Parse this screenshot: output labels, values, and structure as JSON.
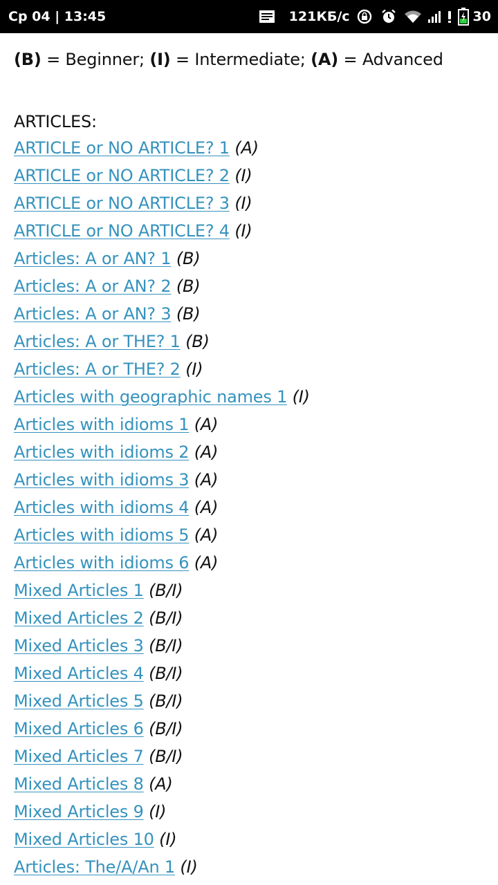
{
  "status_bar": {
    "time": "Ср 04 | 13:45",
    "net_speed": "121КБ/с",
    "battery_level": "30",
    "icons": [
      "notification-icon",
      "vpn-lock-icon",
      "alarm-icon",
      "wifi-icon",
      "signal-icon",
      "battery-charging-icon"
    ]
  },
  "legend": {
    "b_code": "(B)",
    "b_text": " = Beginner; ",
    "i_code": "(I)",
    "i_text": " = Intermediate; ",
    "a_code": "(A)",
    "a_text": " = Advanced"
  },
  "section": {
    "title": "ARTICLES:"
  },
  "lessons": [
    {
      "title": "ARTICLE or NO ARTICLE? 1",
      "level": "(A)"
    },
    {
      "title": "ARTICLE or NO ARTICLE? 2",
      "level": "(I)"
    },
    {
      "title": "ARTICLE or NO ARTICLE? 3",
      "level": "(I)"
    },
    {
      "title": "ARTICLE or NO ARTICLE? 4",
      "level": "(I)"
    },
    {
      "title": "Articles: A or AN? 1",
      "level": "(B)"
    },
    {
      "title": "Articles: A or AN? 2",
      "level": "(B)"
    },
    {
      "title": "Articles: A or AN? 3",
      "level": "(B)"
    },
    {
      "title": "Articles: A or THE? 1",
      "level": "(B)"
    },
    {
      "title": "Articles: A or THE? 2",
      "level": "(I)"
    },
    {
      "title": "Articles with geographic names 1",
      "level": "(I)"
    },
    {
      "title": "Articles with idioms 1",
      "level": "(A)"
    },
    {
      "title": "Articles with idioms 2",
      "level": "(A)"
    },
    {
      "title": "Articles with idioms 3",
      "level": "(A)"
    },
    {
      "title": "Articles with idioms 4",
      "level": "(A)"
    },
    {
      "title": "Articles with idioms 5",
      "level": "(A)"
    },
    {
      "title": "Articles with idioms 6",
      "level": "(A)"
    },
    {
      "title": "Mixed Articles 1",
      "level": "(B/I)"
    },
    {
      "title": "Mixed Articles 2",
      "level": "(B/I)"
    },
    {
      "title": "Mixed Articles 3",
      "level": "(B/I)"
    },
    {
      "title": "Mixed Articles 4",
      "level": "(B/I)"
    },
    {
      "title": "Mixed Articles 5",
      "level": "(B/I)"
    },
    {
      "title": "Mixed Articles 6",
      "level": "(B/I)"
    },
    {
      "title": "Mixed Articles 7",
      "level": "(B/I)"
    },
    {
      "title": "Mixed Articles 8",
      "level": "(A)"
    },
    {
      "title": "Mixed Articles 9",
      "level": "(I)"
    },
    {
      "title": "Mixed Articles 10",
      "level": "(I)"
    },
    {
      "title": "Articles: The/A/An 1",
      "level": "(I)"
    }
  ],
  "colors": {
    "link": "#3592bd",
    "text": "#111111",
    "status_bar_bg": "#000000",
    "battery_charge": "#2ecc40"
  }
}
